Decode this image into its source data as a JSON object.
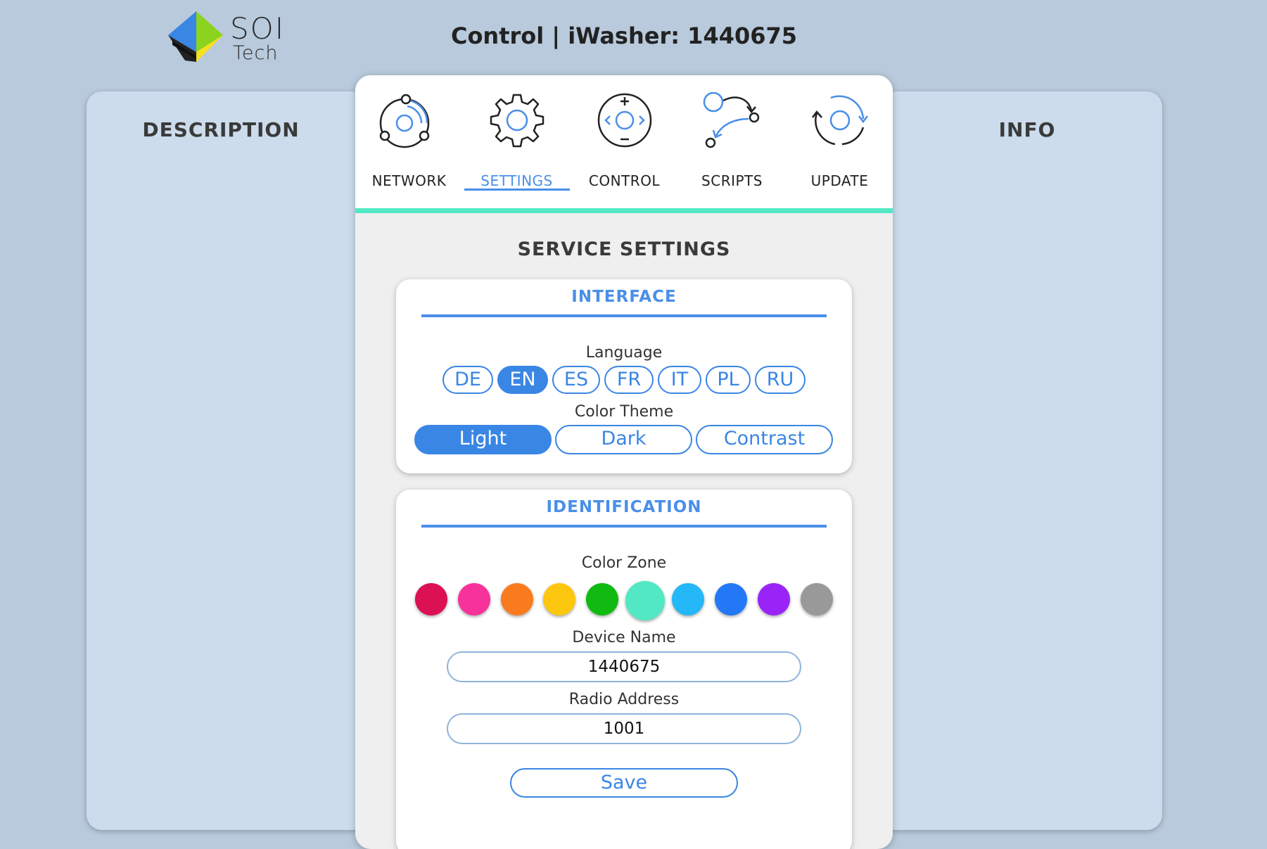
{
  "header": {
    "logo_line1": "SOI",
    "logo_line2": "Tech",
    "title": "Control | iWasher: 1440675"
  },
  "left_panel": {
    "title": "DESCRIPTION"
  },
  "right_panel": {
    "title": "INFO"
  },
  "nav": {
    "items": [
      {
        "label": "NETWORK",
        "icon": "network-icon",
        "active": false
      },
      {
        "label": "SETTINGS",
        "icon": "gear-icon",
        "active": true
      },
      {
        "label": "CONTROL",
        "icon": "control-icon",
        "active": false
      },
      {
        "label": "SCRIPTS",
        "icon": "scripts-icon",
        "active": false
      },
      {
        "label": "UPDATE",
        "icon": "update-icon",
        "active": false
      }
    ],
    "accent_color": "#52e8c4",
    "active_color": "#4a8fe8"
  },
  "section_title": "SERVICE SETTINGS",
  "interface_card": {
    "title": "INTERFACE",
    "language_label": "Language",
    "languages": [
      "DE",
      "EN",
      "ES",
      "FR",
      "IT",
      "PL",
      "RU"
    ],
    "selected_language": "EN",
    "theme_label": "Color Theme",
    "themes": [
      "Light",
      "Dark",
      "Contrast"
    ],
    "selected_theme": "Light"
  },
  "identification_card": {
    "title": "IDENTIFICATION",
    "color_zone_label": "Color Zone",
    "colors": [
      "#dc1153",
      "#f7339b",
      "#f97b1d",
      "#fdc60f",
      "#10ba10",
      "#52e8c4",
      "#24b8f8",
      "#2378f7",
      "#9a24f8",
      "#999999"
    ],
    "selected_color": "#52e8c4",
    "device_name_label": "Device Name",
    "device_name": "1440675",
    "radio_address_label": "Radio Address",
    "radio_address": "1001",
    "save_label": "Save"
  }
}
